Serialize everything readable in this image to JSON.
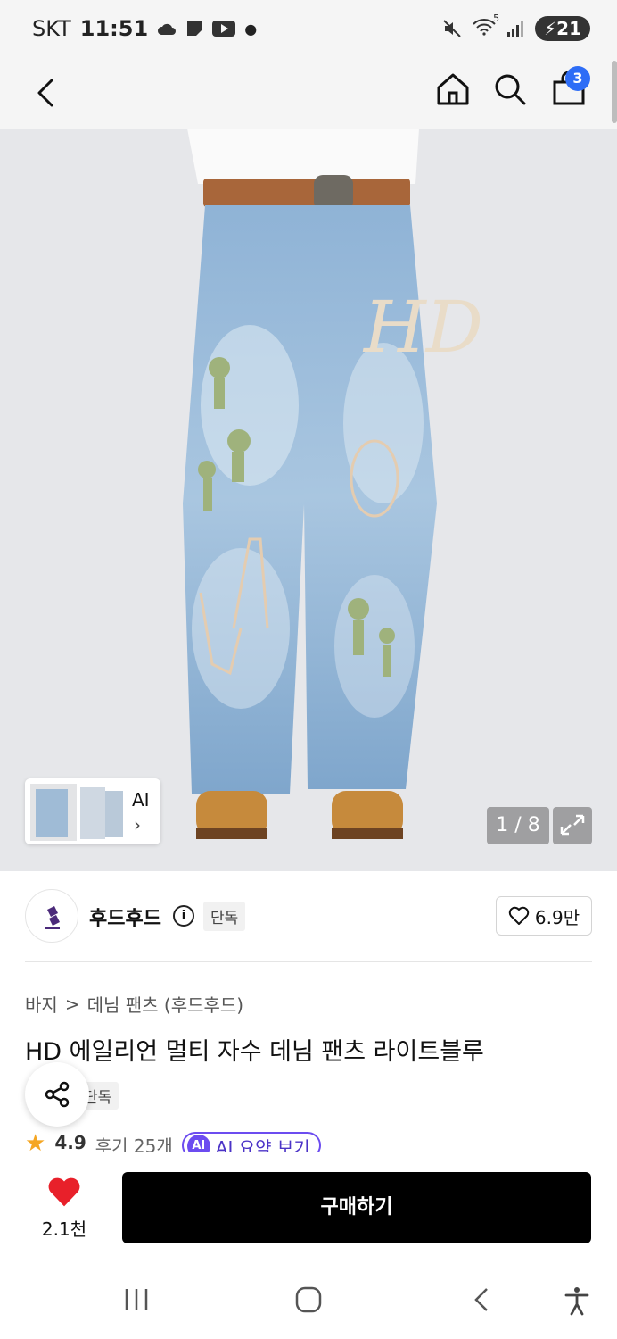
{
  "status_bar": {
    "carrier": "SKT",
    "time": "11:51",
    "battery": "21",
    "wifi_label": "5"
  },
  "header": {
    "cart_count": "3"
  },
  "gallery": {
    "thumbnail_label": "AI",
    "counter": "1 / 8",
    "print_letters": "HD"
  },
  "brand": {
    "name": "후드후드",
    "exclusive_tag": "단독",
    "likes": "6.9만"
  },
  "breadcrumb": {
    "level1": "바지",
    "separator": ">",
    "level2": "데님 팬츠 (후드후드)"
  },
  "product": {
    "title": "HD 에일리언 멀티 자수 데님 팬츠 라이트블루",
    "exclusive_tag": "단독",
    "rating": "4.9",
    "reviews": "후기 25개",
    "ai_badge": "AI",
    "ai_summary": "AI 요약 보기"
  },
  "bottom_bar": {
    "like_count": "2.1천",
    "buy_label": "구매하기"
  },
  "colors": {
    "accent_blue": "#2e6df6",
    "heart_red": "#e8202a",
    "ai_purple": "#6c4cf0",
    "buy_button": "#000000"
  }
}
